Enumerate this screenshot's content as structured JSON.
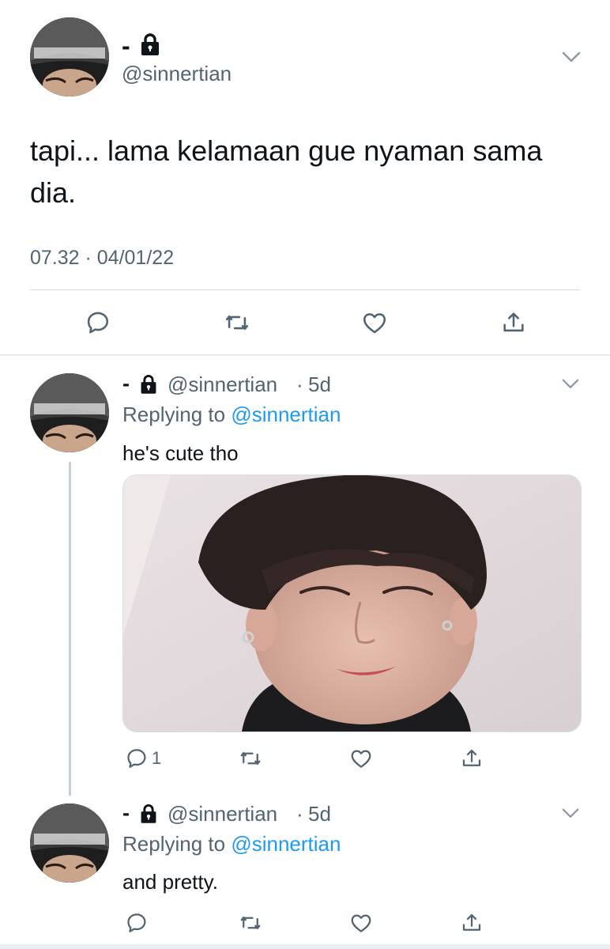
{
  "main_tweet": {
    "name": "-",
    "handle": "@sinnertian",
    "text": "tapi... lama kelamaan gue nyaman sama dia.",
    "timestamp": "07.32 · 04/01/22",
    "icons": [
      "reply-icon",
      "retweet-icon",
      "like-icon",
      "share-icon"
    ]
  },
  "replies": [
    {
      "name": "-",
      "handle": "@sinnertian",
      "separator": "·",
      "time": "5d",
      "replying_prefix": "Replying to",
      "replying_handle": "@sinnertian",
      "text": "he's cute tho",
      "reply_count": "1"
    },
    {
      "name": "-",
      "handle": "@sinnertian",
      "separator": "·",
      "time": "5d",
      "replying_prefix": "Replying to",
      "replying_handle": "@sinnertian",
      "text": "and pretty."
    }
  ],
  "colors": {
    "accent": "#1d9bf0",
    "secondary_text": "#536471",
    "primary_text": "#0f1419"
  }
}
